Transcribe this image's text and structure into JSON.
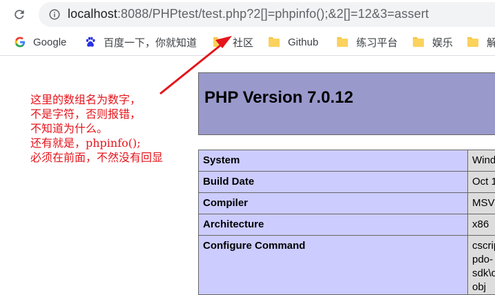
{
  "browser": {
    "url_host": "localhost",
    "url_rest": ":8088/PHPtest/test.php?2[]=phpinfo();&2[]=12&3=assert"
  },
  "bookmarks": [
    {
      "label": "Google",
      "icon": "google-icon"
    },
    {
      "label": "百度一下，你就知道",
      "icon": "baidu-paw-icon"
    },
    {
      "label": "社区",
      "icon": "folder-icon"
    },
    {
      "label": "Github",
      "icon": "folder-icon"
    },
    {
      "label": "练习平台",
      "icon": "folder-icon"
    },
    {
      "label": "娱乐",
      "icon": "folder-icon"
    },
    {
      "label": "解",
      "icon": "folder-icon"
    }
  ],
  "annotation": {
    "lines": [
      "这里的数组名为数字，",
      "不是字符，否则报错，",
      "不知道为什么。",
      "还有就是，phpinfo();",
      "必须在前面，不然没有回显"
    ],
    "color": "#e5141b"
  },
  "phpinfo": {
    "title": "PHP Version 7.0.12",
    "header_color": "#9999cc",
    "rows": [
      {
        "key": "System",
        "value": "Wind"
      },
      {
        "key": "Build Date",
        "value": "Oct 1"
      },
      {
        "key": "Compiler",
        "value": "MSVC"
      },
      {
        "key": "Architecture",
        "value": "x86"
      },
      {
        "key": "Configure Command",
        "value_lines": [
          "cscrip",
          "pdo-",
          "sdk\\o",
          "obj"
        ]
      }
    ]
  }
}
